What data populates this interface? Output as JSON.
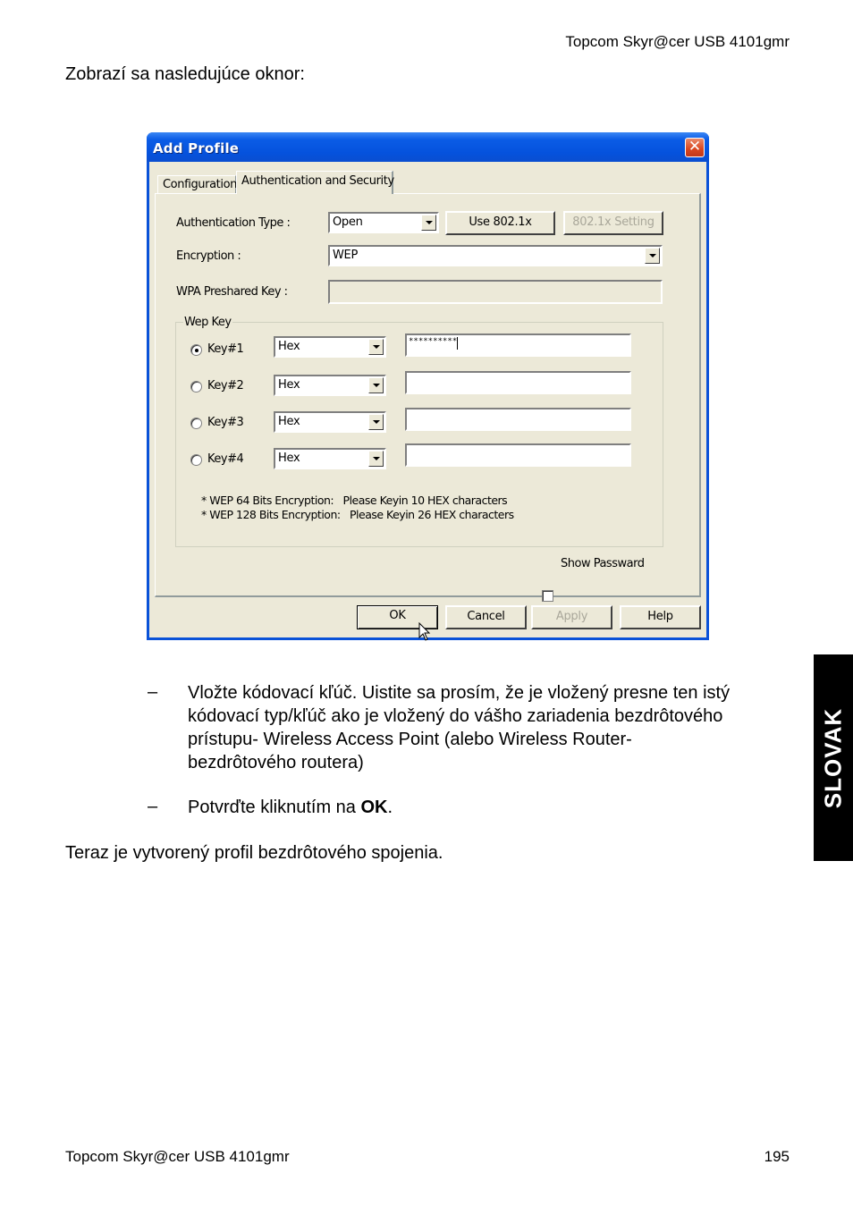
{
  "page": {
    "header_product": "Topcom Skyr@cer USB 4101gmr",
    "intro_text": "Zobrazí sa nasledujúce oknor:",
    "bullets": [
      {
        "dash": "–",
        "lines": [
          "Vložte kódovací kľúč. Uistite sa prosím, že je vložený presne ten istý",
          "kódovací typ/kľúč ako je vložený do vášho zariadenia bezdrôtového",
          "prístupu- Wireless Access Point (alebo Wireless Router-",
          "bezdrôtového routera)"
        ]
      },
      {
        "dash": "–",
        "text_before": "Potvrďte kliknutím na ",
        "text_bold": "OK",
        "text_after": "."
      }
    ],
    "closing_text": "Teraz je vytvorený profil bezdrôtového spojenia.",
    "side_tab_label": "SLOVAK",
    "footer_product": "Topcom Skyr@cer USB 4101gmr",
    "page_number": "195"
  },
  "dialog": {
    "title": "Add Profile",
    "close_glyph": "✕",
    "tabs": [
      {
        "label": "Configuration",
        "active": false
      },
      {
        "label": "Authentication and Security",
        "active": true
      }
    ],
    "authentication_type": {
      "label": "Authentication Type :",
      "value": "Open"
    },
    "use_8021x_button": "Use 802.1x",
    "setting_8021x_button": "802.1x Setting",
    "encryption": {
      "label": "Encryption :",
      "value": "WEP"
    },
    "wpa_preshared_key": {
      "label": "WPA Preshared Key :",
      "value": ""
    },
    "wep_key_group": {
      "title": "Wep Key",
      "keys": [
        {
          "label": "Key#1",
          "selected": true,
          "format": "Hex",
          "value": "**********"
        },
        {
          "label": "Key#2",
          "selected": false,
          "format": "Hex",
          "value": ""
        },
        {
          "label": "Key#3",
          "selected": false,
          "format": "Hex",
          "value": ""
        },
        {
          "label": "Key#4",
          "selected": false,
          "format": "Hex",
          "value": ""
        }
      ],
      "notes": [
        "* WEP 64 Bits Encryption:   Please Keyin 10 HEX characters",
        "* WEP 128 Bits Encryption:   Please Keyin 26 HEX characters"
      ]
    },
    "show_password": {
      "label": "Show Passward",
      "checked": false
    },
    "buttons": {
      "ok": "OK",
      "cancel": "Cancel",
      "apply": "Apply",
      "help": "Help"
    }
  }
}
